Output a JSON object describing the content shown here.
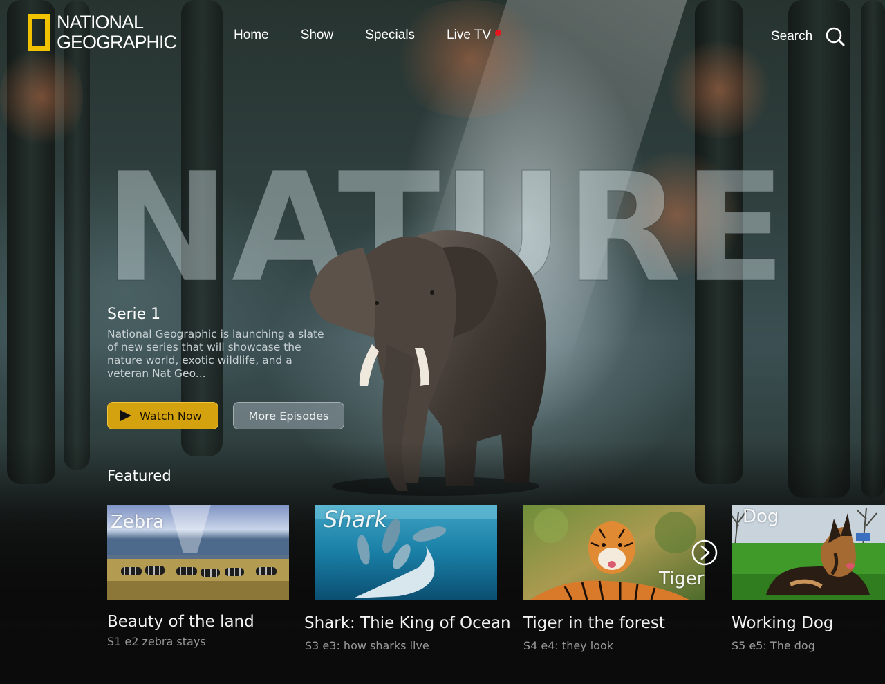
{
  "brand": {
    "line1": "NATIONAL",
    "line2": "GEOGRAPHIC",
    "frame_color": "#f2c300"
  },
  "nav": {
    "items": [
      {
        "label": "Home"
      },
      {
        "label": "Show"
      },
      {
        "label": "Specials"
      },
      {
        "label": "Live TV"
      }
    ],
    "live_indicator_color": "#e8141b"
  },
  "search": {
    "label": "Search",
    "icon": "search-icon"
  },
  "hero": {
    "big_title": "NATURE",
    "series_title": "Serie 1",
    "description": "National Geographic is launching a slate of new series  that will showcase the nature world, exotic wildlife, and a veteran Nat Geo...",
    "watch_button": "Watch Now",
    "more_button": "More Episodes",
    "watch_button_color": "#d4a20e"
  },
  "featured": {
    "label": "Featured",
    "next_icon": "chevron-right-circle-icon",
    "cards": [
      {
        "thumb_label": "Zebra",
        "title": "Beauty of the land",
        "subtitle": "S1 e2 zebra stays"
      },
      {
        "thumb_label": "Shark",
        "title": "Shark: Thie King of Ocean",
        "subtitle": "S3 e3: how sharks live"
      },
      {
        "thumb_label": "Tiger",
        "title": "Tiger in the forest",
        "subtitle": "S4 e4: they look"
      },
      {
        "thumb_label": "Dog",
        "title": "Working Dog",
        "subtitle": "S5 e5: The dog"
      }
    ]
  }
}
